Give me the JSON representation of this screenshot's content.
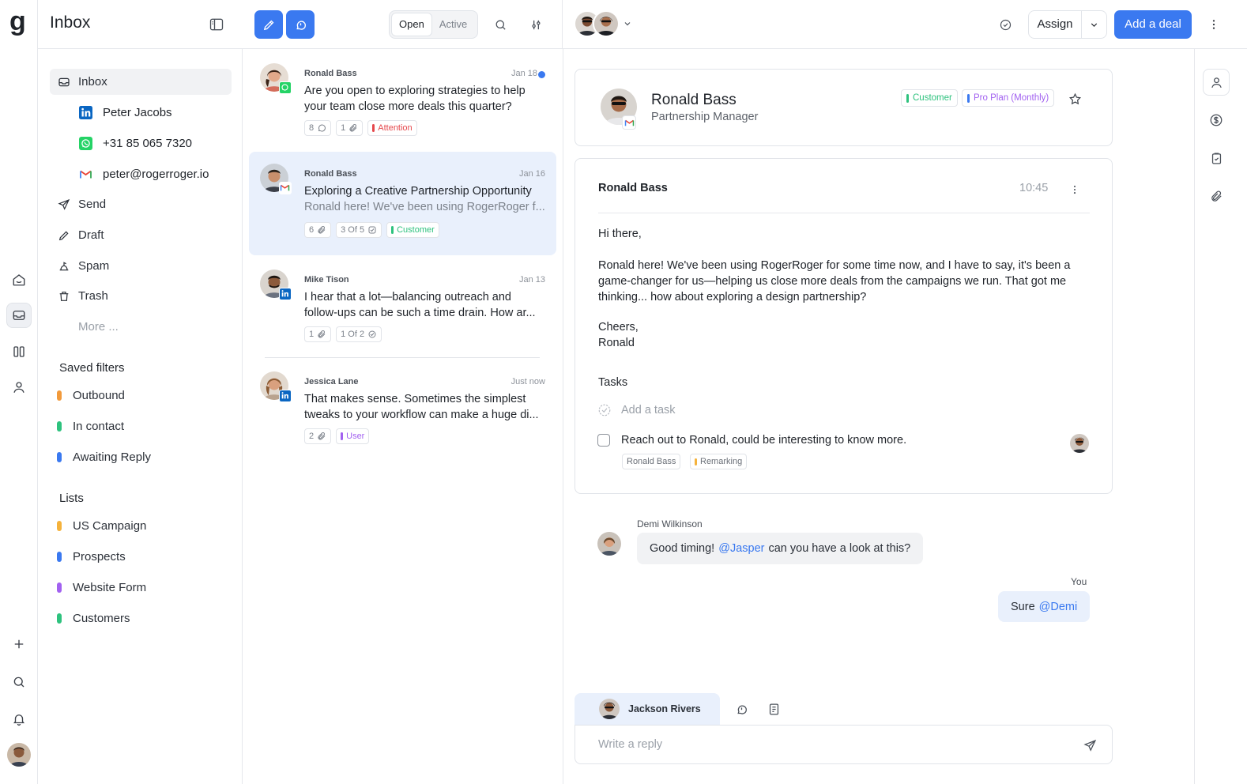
{
  "app": {
    "logo": "g",
    "title": "Inbox"
  },
  "toolbar": {
    "segment": [
      "Open",
      "Active"
    ],
    "assign_label": "Assign",
    "add_deal_label": "Add a deal"
  },
  "nav": {
    "inbox_label": "Inbox",
    "accounts": [
      {
        "icon": "linkedin-icon",
        "label": "Peter Jacobs"
      },
      {
        "icon": "whatsapp-icon",
        "label": "+31 85 065 7320"
      },
      {
        "icon": "gmail-icon",
        "label": "peter@rogerroger.io"
      }
    ],
    "folders": [
      {
        "icon": "send-icon",
        "label": "Send"
      },
      {
        "icon": "draft-icon",
        "label": "Draft"
      },
      {
        "icon": "spam-icon",
        "label": "Spam"
      },
      {
        "icon": "trash-icon",
        "label": "Trash"
      }
    ],
    "more_label": "More ...",
    "saved_filters_heading": "Saved filters",
    "saved_filters": [
      {
        "label": "Outbound",
        "color": "#f29a3b"
      },
      {
        "label": "In contact",
        "color": "#2ec27e"
      },
      {
        "label": "Awaiting Reply",
        "color": "#3a79f0"
      }
    ],
    "lists_heading": "Lists",
    "lists": [
      {
        "label": "US Campaign",
        "color": "#f5b23b"
      },
      {
        "label": "Prospects",
        "color": "#3a79f0"
      },
      {
        "label": "Website Form",
        "color": "#a261f0"
      },
      {
        "label": "Customers",
        "color": "#2ec27e"
      }
    ]
  },
  "messages": [
    {
      "from": "Ronald Bass",
      "date": "Jan 18",
      "unread": true,
      "channel": "whatsapp-icon",
      "subject": "Are you open to exploring strategies to help your team close more deals this quarter?",
      "preview": "",
      "chips": [
        {
          "text": "8",
          "icon": "comment-icon"
        },
        {
          "text": "1",
          "icon": "paperclip-icon"
        },
        {
          "text": "Attention",
          "color": "#e5484d",
          "tag": true
        }
      ]
    },
    {
      "from": "Ronald Bass",
      "date": "Jan 16",
      "unread": false,
      "channel": "gmail-icon",
      "subject": "Exploring a Creative Partnership Opportunity",
      "preview": "Ronald here! We've been using RogerRoger f...",
      "chips": [
        {
          "text": "6",
          "icon": "paperclip-icon"
        },
        {
          "text": "3 Of 5",
          "icon": "check-icon"
        },
        {
          "text": "Customer",
          "color": "#2ec27e",
          "tag": true
        }
      ]
    },
    {
      "from": "Mike Tison",
      "date": "Jan 13",
      "unread": false,
      "channel": "linkedin-icon",
      "subject": "I hear that a lot—balancing outreach and follow-ups can be such a time drain. How ar...",
      "preview": "",
      "chips": [
        {
          "text": "1",
          "icon": "paperclip-icon"
        },
        {
          "text": "1 Of 2",
          "icon": "check-icon"
        }
      ]
    },
    {
      "from": "Jessica Lane",
      "date": "Just now",
      "unread": false,
      "channel": "linkedin-icon",
      "subject": "That makes sense. Sometimes the simplest tweaks to your workflow can make a huge di...",
      "preview": "",
      "chips": [
        {
          "text": "2",
          "icon": "paperclip-icon"
        },
        {
          "text": "User",
          "color": "#a261f0",
          "tag": true
        }
      ]
    }
  ],
  "contact": {
    "name": "Ronald Bass",
    "role": "Partnership Manager",
    "tags": [
      {
        "text": "Customer",
        "color": "#2ec27e"
      },
      {
        "text": "Pro Plan (Monthly)",
        "color": "#a261f0"
      }
    ]
  },
  "email": {
    "sender": "Ronald Bass",
    "time": "10:45",
    "greeting": "Hi there,",
    "body": "Ronald here! We've been using RogerRoger for some time now, and I have to say, it's been a game-changer for us—helping us close more deals from the campaigns we run. That got me thinking... how about exploring a design partnership?",
    "signoff": "Cheers,",
    "signature": "Ronald"
  },
  "tasks": {
    "heading": "Tasks",
    "add_placeholder": "Add a task",
    "items": [
      {
        "text": "Reach out to Ronald, could be interesting to know more.",
        "tags": [
          "Ronald Bass",
          "Remarking"
        ]
      }
    ]
  },
  "chat": {
    "incoming_author": "Demi Wilkinson",
    "incoming_prefix": "Good timing!",
    "incoming_mention": "@Jasper",
    "incoming_suffix": "can you have a look at this?",
    "outgoing_author": "You",
    "outgoing_prefix": "Sure",
    "outgoing_mention": "@Demi"
  },
  "composer": {
    "tab_name": "Jackson Rivers",
    "placeholder": "Write a reply"
  },
  "colors": {
    "accent": "#3a79f0",
    "selected_row": "#e9f0fc"
  }
}
